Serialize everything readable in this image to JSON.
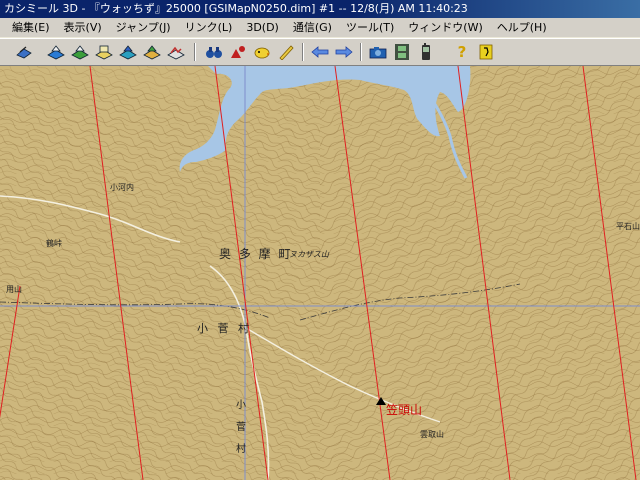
{
  "window": {
    "title": "カシミール 3D - 『ウォッちず』25000 [GSIMapN0250.dim] #1 -- 12/8(月) AM 11:40:23"
  },
  "menu": {
    "items": [
      {
        "label": "編集(E)"
      },
      {
        "label": "表示(V)"
      },
      {
        "label": "ジャンプ(J)"
      },
      {
        "label": "リンク(L)"
      },
      {
        "label": "3D(D)"
      },
      {
        "label": "通信(G)"
      },
      {
        "label": "ツール(T)"
      },
      {
        "label": "ウィンドウ(W)"
      },
      {
        "label": "ヘルプ(H)"
      }
    ]
  },
  "toolbar": {
    "tools": [
      {
        "icon": "open-map-icon",
        "glyph": "◆",
        "color": "#1f4fa8"
      },
      {
        "icon": "layer-blue-icon",
        "glyph": "◆",
        "color": "#2a7bd4"
      },
      {
        "icon": "layer-green-icon",
        "glyph": "◆",
        "color": "#3b9e3b"
      },
      {
        "icon": "layer-yellow-icon",
        "glyph": "◆",
        "color": "#d4b020"
      },
      {
        "icon": "layer-cyan-icon",
        "glyph": "◆",
        "color": "#2aa0c0"
      },
      {
        "icon": "layer-mixed-icon",
        "glyph": "◆",
        "color": "#c07030"
      },
      {
        "icon": "layer-red-icon",
        "glyph": "◆",
        "color": "#c03030"
      },
      {
        "icon": "binoculars-icon",
        "glyph": "●",
        "color": "#2050a0"
      },
      {
        "icon": "marker-red-icon",
        "glyph": "▲",
        "color": "#c02020"
      },
      {
        "icon": "chick-icon",
        "glyph": "●",
        "color": "#e0c020"
      },
      {
        "icon": "ruler-icon",
        "glyph": "/",
        "color": "#b09020"
      },
      {
        "icon": "arrow-left-icon",
        "glyph": "⇐",
        "color": "#2050c0"
      },
      {
        "icon": "arrow-right-icon",
        "glyph": "⇒",
        "color": "#2050c0"
      },
      {
        "icon": "camera-icon",
        "glyph": "■",
        "color": "#2060b0"
      },
      {
        "icon": "film-icon",
        "glyph": "▦",
        "color": "#307030"
      },
      {
        "icon": "gps-icon",
        "glyph": "▮",
        "color": "#404040"
      },
      {
        "icon": "help-icon",
        "glyph": "?",
        "color": "#d0a000"
      },
      {
        "icon": "exit-icon",
        "glyph": "■",
        "color": "#d0b000"
      }
    ]
  },
  "map": {
    "place_names": [
      {
        "text": "奥 多 摩 町"
      },
      {
        "text": "小 菅 村"
      },
      {
        "text": "小"
      },
      {
        "text": "菅"
      },
      {
        "text": "村"
      },
      {
        "text": "ヌカザス山"
      },
      {
        "text": "鶴峠"
      },
      {
        "text": "用山"
      },
      {
        "text": "雲取山"
      },
      {
        "text": "小河内"
      },
      {
        "text": "平石山"
      }
    ],
    "marker": {
      "label": "笠頭山",
      "color": "#cc0000"
    },
    "colors": {
      "land": "#cdb77d",
      "water": "#a7c6e6",
      "contour": "#8a6a32",
      "grid_red": "#e02020",
      "grid_blue": "#7f8fcc",
      "road": "#f4f0e0"
    }
  }
}
